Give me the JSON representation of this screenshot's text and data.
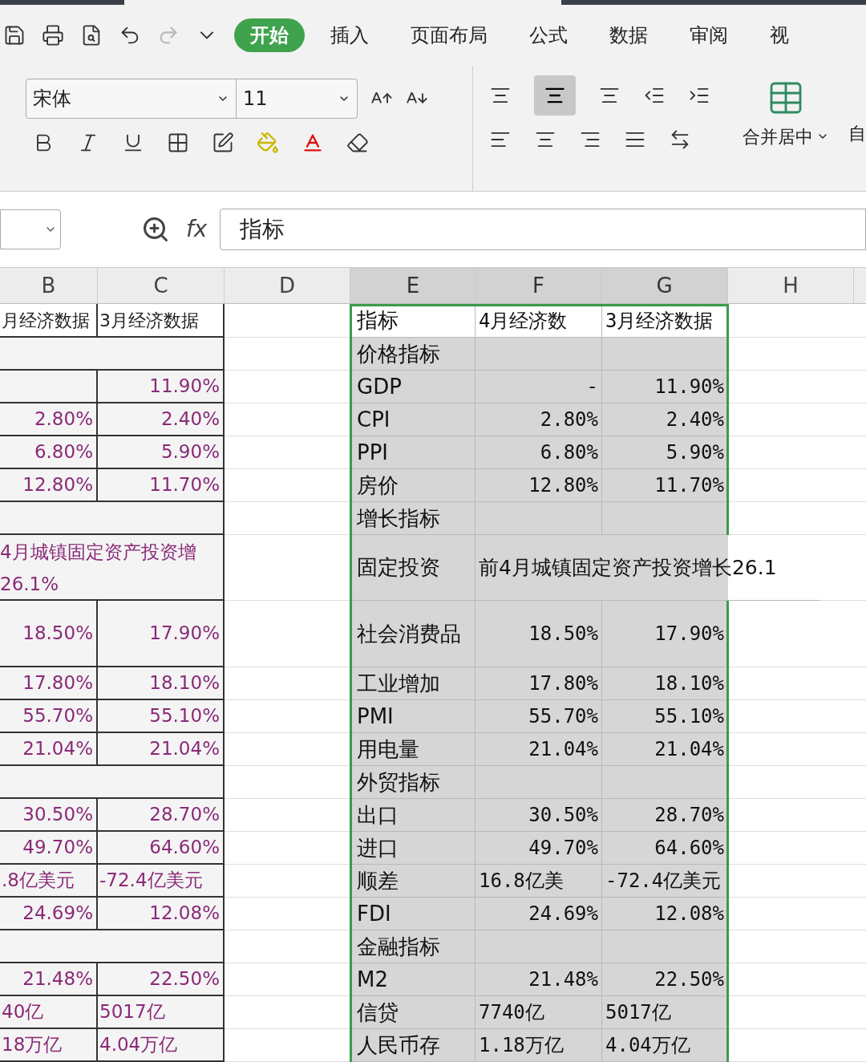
{
  "menu_tabs": [
    {
      "label": "开始",
      "selected": true
    },
    {
      "label": "插入",
      "selected": false
    },
    {
      "label": "页面布局",
      "selected": false
    },
    {
      "label": "公式",
      "selected": false
    },
    {
      "label": "数据",
      "selected": false
    },
    {
      "label": "审阅",
      "selected": false
    },
    {
      "label": "视",
      "selected": false
    }
  ],
  "font_name": "宋体",
  "font_size": "11",
  "merge_button": "合并居中",
  "cut_button": "自",
  "formula_bar": {
    "fx": "fx",
    "value": "指标"
  },
  "columns": [
    {
      "label": "B",
      "selected": false
    },
    {
      "label": "C",
      "selected": false
    },
    {
      "label": "D",
      "selected": false
    },
    {
      "label": "E",
      "selected": true
    },
    {
      "label": "F",
      "selected": true
    },
    {
      "label": "G",
      "selected": true
    },
    {
      "label": "H",
      "selected": false
    }
  ],
  "rows": [
    {
      "kind": "header",
      "b": "月经济数据",
      "c": "3月经济数据",
      "e": "指标",
      "f": "4月经济数",
      "g": "3月经济数据"
    },
    {
      "kind": "section",
      "e": "价格指标"
    },
    {
      "kind": "value",
      "c": "11.90%",
      "e": "GDP",
      "f": "-",
      "g": "11.90%"
    },
    {
      "kind": "value",
      "b": "2.80%",
      "c": "2.40%",
      "e": "CPI",
      "f": "2.80%",
      "g": "2.40%"
    },
    {
      "kind": "value",
      "b": "6.80%",
      "c": "5.90%",
      "e": "PPI",
      "f": "6.80%",
      "g": "5.90%"
    },
    {
      "kind": "value",
      "b": "12.80%",
      "c": "11.70%",
      "e": "房价",
      "f": "12.80%",
      "g": "11.70%"
    },
    {
      "kind": "section",
      "e": "增长指标"
    },
    {
      "kind": "merged",
      "b_lines": [
        "4月城镇固定资产投资增",
        "26.1%"
      ],
      "e": "固定投资",
      "f": "前4月城镇固定资产投资增长26.1"
    },
    {
      "kind": "value",
      "tall": true,
      "b": "18.50%",
      "c": "17.90%",
      "e": "社会消费品",
      "f": "18.50%",
      "g": "17.90%"
    },
    {
      "kind": "value",
      "b": "17.80%",
      "c": "18.10%",
      "e": "工业增加",
      "f": "17.80%",
      "g": "18.10%"
    },
    {
      "kind": "value",
      "b": "55.70%",
      "c": "55.10%",
      "e": "PMI",
      "f": "55.70%",
      "g": "55.10%"
    },
    {
      "kind": "value",
      "b": "21.04%",
      "c": "21.04%",
      "e": "用电量",
      "f": "21.04%",
      "g": "21.04%"
    },
    {
      "kind": "section",
      "e": "外贸指标"
    },
    {
      "kind": "value",
      "b": "30.50%",
      "c": "28.70%",
      "e": "出口",
      "f": "30.50%",
      "g": "28.70%"
    },
    {
      "kind": "value",
      "b": "49.70%",
      "c": "64.60%",
      "e": "进口",
      "f": "49.70%",
      "g": "64.60%"
    },
    {
      "kind": "value",
      "b": ".8亿美元",
      "c": "-72.4亿美元",
      "e": "顺差",
      "f": "16.8亿美",
      "g": "-72.4亿美元",
      "left": true
    },
    {
      "kind": "value",
      "b": "24.69%",
      "c": "12.08%",
      "e": "FDI",
      "f": "24.69%",
      "g": "12.08%"
    },
    {
      "kind": "section",
      "e": "金融指标"
    },
    {
      "kind": "value",
      "b": "21.48%",
      "c": "22.50%",
      "e": "M2",
      "f": "21.48%",
      "g": "22.50%"
    },
    {
      "kind": "value",
      "b": "40亿",
      "c": "5017亿",
      "e": "信贷",
      "f": "7740亿",
      "g": "5017亿",
      "left": true
    },
    {
      "kind": "value",
      "b": "18万亿",
      "c": "4.04万亿",
      "e": "人民币存",
      "f": "1.18万亿",
      "g": "4.04万亿",
      "left": true
    }
  ]
}
